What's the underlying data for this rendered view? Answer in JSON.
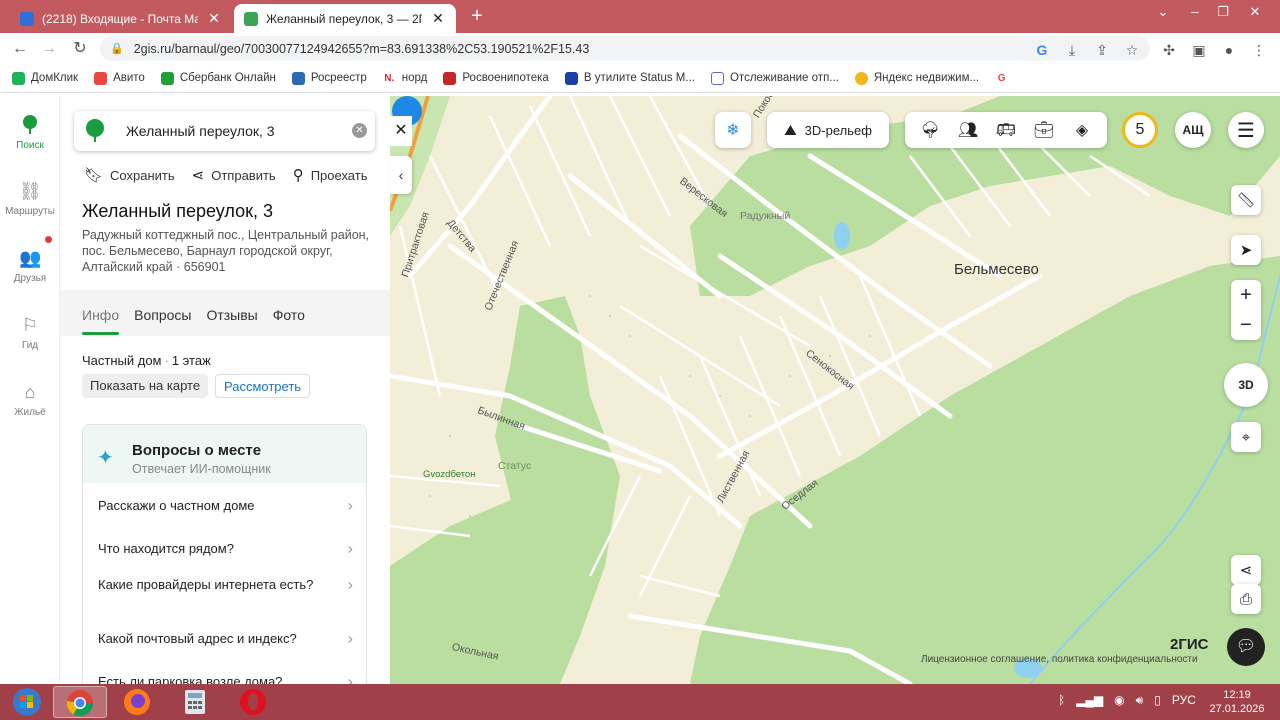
{
  "browser": {
    "tabs": [
      {
        "title": "(2218) Входящие - Почта Mail",
        "active": false
      },
      {
        "title": "Желанный переулок, 3 — 2ГИС",
        "active": true
      }
    ],
    "url": "2gis.ru/barnaul/geo/70030077124942655?m=83.691338%2C53.190521%2F15.43",
    "bookmarks": [
      "ДомКлик",
      "Авито",
      "Сбербанк Онлайн",
      "Росреестр",
      "норд",
      "Росвоенипотека",
      "В утилите Status M...",
      "Отслеживание отп...",
      "Яндекс недвижим..."
    ]
  },
  "nav": {
    "items": [
      {
        "label": "Поиск",
        "icon": "tree-pin-icon"
      },
      {
        "label": "Маршруты",
        "icon": "routes-icon"
      },
      {
        "label": "Друзья",
        "icon": "friends-icon"
      },
      {
        "label": "Гид",
        "icon": "flag-icon"
      },
      {
        "label": "Жильё",
        "icon": "housing-icon"
      }
    ]
  },
  "panel": {
    "search_value": "Желанный переулок, 3",
    "actions": {
      "save": "Сохранить",
      "send": "Отправить",
      "route": "Проехать"
    },
    "title": "Желанный переулок, 3",
    "address": "Радужный коттеджный пос., Центральный район, пос. Бельмесево, Барнаул городской округ, Алтайский край · 656901",
    "tabs": [
      "Инфо",
      "Вопросы",
      "Отзывы",
      "Фото"
    ],
    "building_type": "Частный дом",
    "floors": "1 этаж",
    "show_on_map": "Показать на карте",
    "view": "Рассмотреть",
    "qa": {
      "title": "Вопросы о месте",
      "subtitle": "Отвечает ИИ-помощник",
      "questions": [
        "Расскажи о частном доме",
        "Что находится рядом?",
        "Какие провайдеры интернета есть?",
        "Какой почтовый адрес и индекс?",
        "Есть ли парковка возле дома?"
      ]
    }
  },
  "map": {
    "relief_label": "3D-рельеф",
    "zoom_level": "5",
    "user_initials": "АЩ",
    "btn_3d": "3D",
    "village": "Бельмесево",
    "locality": "Радужный",
    "poi": "Gvozdбетон",
    "poi_status": "Статус",
    "streets": [
      "Вересковая",
      "Детства",
      "Отечественная",
      "Притрактовая",
      "Былинная",
      "Сенокосная",
      "Лиственная",
      "Оседлая",
      "Окольная",
      "Покосная"
    ],
    "logo": "2ГИС",
    "legal": "Лицензионное соглашение, политика конфиденциальности",
    "colors": {
      "forest": "#b9dea0",
      "land": "#f3eed8",
      "road": "#ffffff",
      "water": "#8fd0ee",
      "pin": "#1e88e5"
    }
  },
  "taskbar": {
    "lang": "РУС",
    "time": "12:19",
    "date": "27.01.2026"
  }
}
